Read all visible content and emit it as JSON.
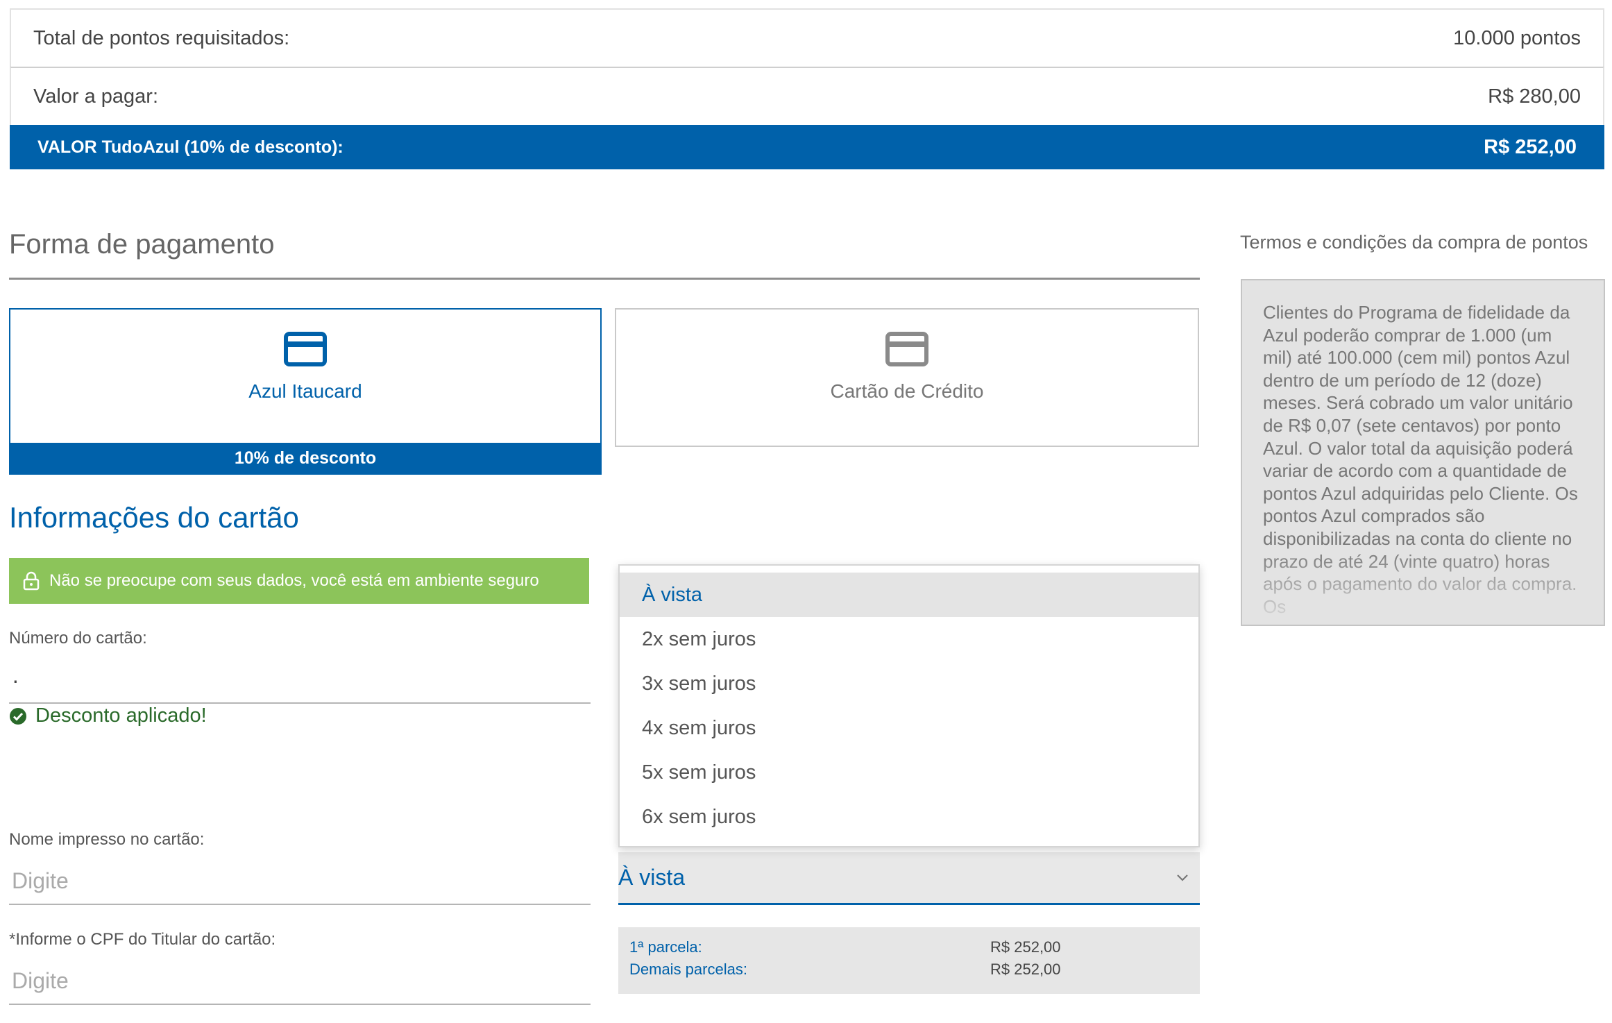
{
  "summary": {
    "total_label": "Total de pontos requisitados:",
    "total_value": "10.000 pontos",
    "pay_label": "Valor a pagar:",
    "pay_value": "R$ 280,00",
    "tudoazul_label": "VALOR TudoAzul (10% de desconto):",
    "tudoazul_value": "R$ 252,00"
  },
  "payment": {
    "title": "Forma de pagamento",
    "options": [
      {
        "label": "Azul Itaucard",
        "badge": "10% de desconto",
        "selected": true
      },
      {
        "label": "Cartão de Crédito",
        "selected": false
      }
    ]
  },
  "card_info": {
    "title": "Informações do cartão",
    "secure_text": "Não se preocupe com seus dados, você está em ambiente seguro",
    "number_label": "Número do cartão:",
    "number_value": "·",
    "discount_text": "Desconto aplicado!",
    "name_label": "Nome impresso no cartão:",
    "name_placeholder": "Digite",
    "cpf_label": "*Informe o CPF do Titular do cartão:",
    "cpf_placeholder": "Digite"
  },
  "installments": {
    "selected": "À vista",
    "options": [
      "À vista",
      "2x sem juros",
      "3x sem juros",
      "4x sem juros",
      "5x sem juros",
      "6x sem juros"
    ],
    "first_label": "1ª parcela:",
    "first_value": "R$ 252,00",
    "rest_label": "Demais parcelas:",
    "rest_value": "R$ 252,00"
  },
  "terms": {
    "title": "Termos e condições da compra de pontos",
    "text": "Clientes do Programa de fidelidade da Azul poderão comprar de 1.000 (um mil) até 100.000 (cem mil) pontos Azul dentro de um período de 12 (doze) meses. Será cobrado um valor unitário de R$ 0,07 (sete centavos) por ponto Azul. O valor total da aquisição poderá variar de acordo com a quantidade de pontos Azul adquiridas pelo Cliente. Os pontos Azul comprados são disponibilizadas na conta do cliente no prazo de até 24 (vinte quatro) horas após o pagamento do valor da compra. Os"
  },
  "colors": {
    "brand_blue": "#0061aa",
    "secure_green": "#8cc45a",
    "success_green": "#2a6a2a"
  },
  "icons": [
    "credit-card-icon",
    "lock-icon",
    "check-circle-icon",
    "chevron-down-icon"
  ]
}
